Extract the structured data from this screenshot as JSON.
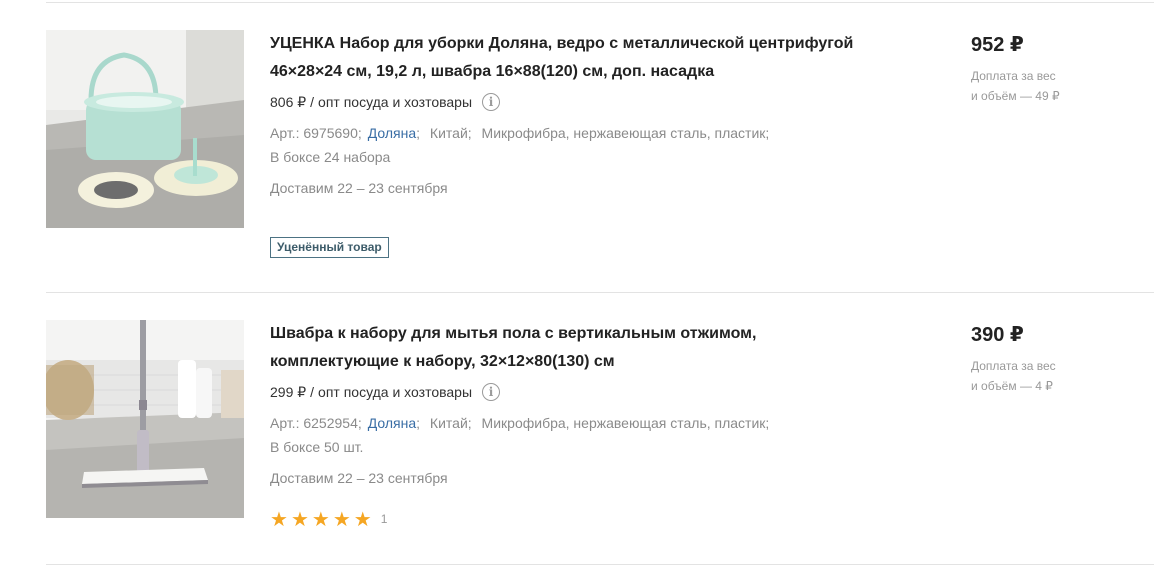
{
  "products": [
    {
      "title_line1": "УЦЕНКА Набор для уборки Доляна, ведро с металлической центрифугой",
      "title_line2": "46×28×24 см, 19,2 л, швабра 16×88(120) см, доп. насадка",
      "opt_price": "806 ₽",
      "opt_separator": "/",
      "opt_category": "опт посуда и хозтовары",
      "art_label": "Арт.: 6975690;",
      "brand": "Доляна",
      "country": "Китай;",
      "materials": "Микрофибра, нержавеющая сталь, пластик;",
      "box": "В боксе 24 набора",
      "delivery": "Доставим 22 – 23 сентября",
      "badge": "Уценённый товар",
      "price": "952 ₽",
      "surcharge_line1": "Доплата за вес",
      "surcharge_line2": "и объём — 49 ₽",
      "image_icon": "mop-bucket-set-image"
    },
    {
      "title_line1": "Швабра к набору для мытья пола с вертикальным отжимом,",
      "title_line2": "комплектующие к набору, 32×12×80(130) см",
      "opt_price": "299 ₽",
      "opt_separator": "/",
      "opt_category": "опт посуда и хозтовары",
      "art_label": "Арт.: 6252954;",
      "brand": "Доляна",
      "country": "Китай;",
      "materials": "Микрофибра, нержавеющая сталь, пластик;",
      "box": "В боксе 50 шт.",
      "delivery": "Доставим 22 – 23 сентября",
      "rating_stars": 5,
      "rating_count": "1",
      "price": "390 ₽",
      "surcharge_line1": "Доплата за вес",
      "surcharge_line2": "и объём — 4 ₽",
      "image_icon": "flat-mop-image"
    }
  ],
  "colors": {
    "link": "#3a6ea5",
    "star": "#f5a623",
    "badge_border": "#4c7283",
    "muted": "#8a8a8a"
  }
}
